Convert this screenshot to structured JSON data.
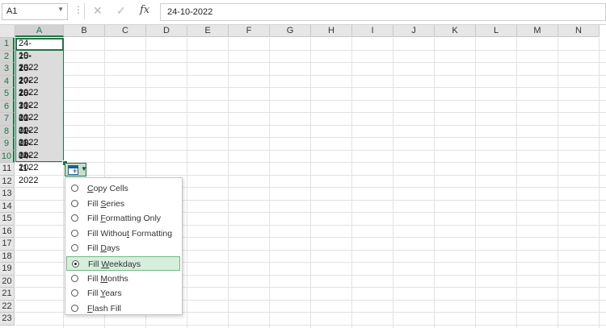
{
  "formula_bar": {
    "name_box": "A1",
    "formula": "24-10-2022",
    "cancel_icon": "x-icon",
    "enter_icon": "check-icon",
    "fx_label": "fx"
  },
  "columns": [
    "A",
    "B",
    "C",
    "D",
    "E",
    "F",
    "G",
    "H",
    "I",
    "J",
    "K",
    "L",
    "M",
    "N"
  ],
  "rows": [
    "1",
    "2",
    "3",
    "4",
    "5",
    "6",
    "7",
    "8",
    "9",
    "10",
    "11",
    "12",
    "13",
    "14",
    "15",
    "16",
    "17",
    "18",
    "19",
    "20",
    "21",
    "22",
    "23"
  ],
  "cells_A": [
    "24-10-2022",
    "25-10-2022",
    "26-10-2022",
    "27-10-2022",
    "28-10-2022",
    "31-10-2022",
    "01-11-2022",
    "02-11-2022",
    "03-11-2022",
    "04-11-2022"
  ],
  "autofill": {
    "button_icon": "auto-fill-options-icon",
    "options": [
      {
        "label": "Copy Cells",
        "accelerator": "C",
        "selected": false
      },
      {
        "label": "Fill Series",
        "accelerator": "S",
        "selected": false
      },
      {
        "label": "Fill Formatting Only",
        "accelerator": "F",
        "selected": false
      },
      {
        "label": "Fill Without Formatting",
        "accelerator": "O",
        "selected": false
      },
      {
        "label": "Fill Days",
        "accelerator": "D",
        "selected": false
      },
      {
        "label": "Fill Weekdays",
        "accelerator": "W",
        "selected": true
      },
      {
        "label": "Fill Months",
        "accelerator": "M",
        "selected": false
      },
      {
        "label": "Fill Years",
        "accelerator": "Y",
        "selected": false
      },
      {
        "label": "Flash Fill",
        "accelerator": "F",
        "selected": false
      }
    ]
  },
  "colors": {
    "accent": "#217346",
    "selection_fill": "#dcdcdc",
    "menu_highlight": "#d6eedc"
  }
}
